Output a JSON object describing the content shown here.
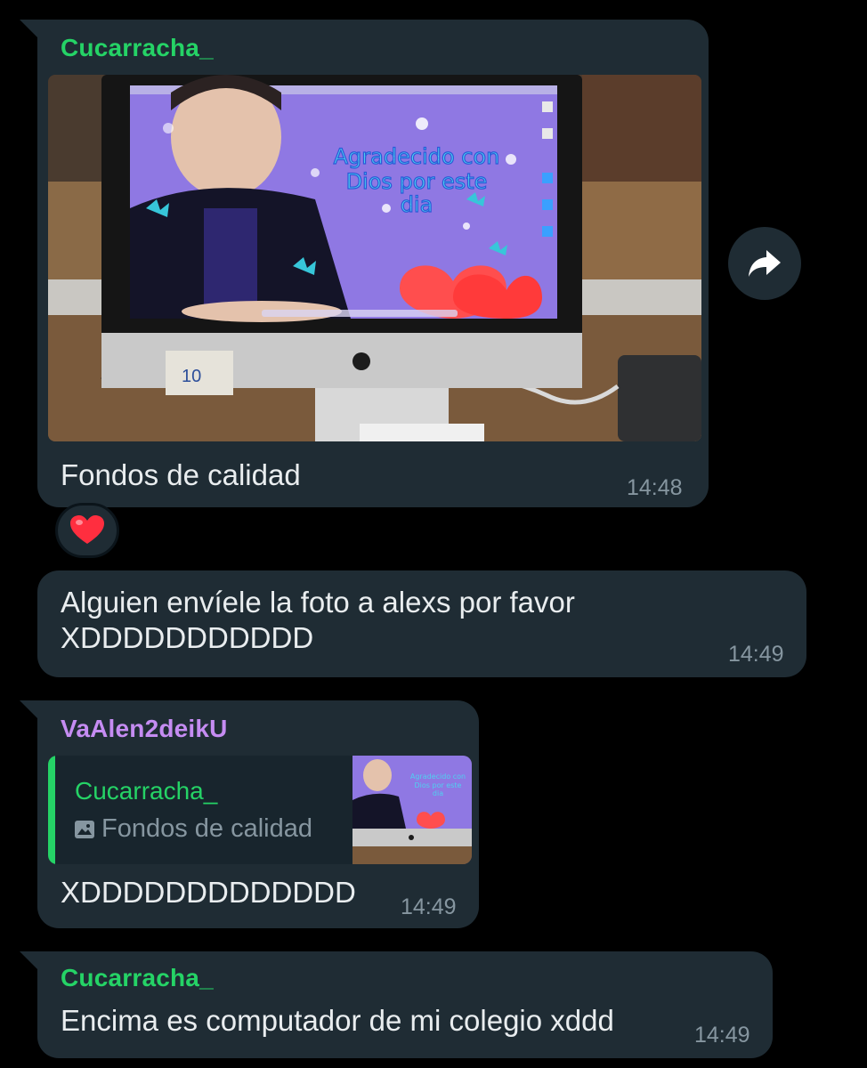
{
  "colors": {
    "background": "#000000",
    "bubble": "#1f2c34",
    "cucarracha_name": "#25d366",
    "vaalen_name": "#c58cf2",
    "time": "#8696a0"
  },
  "messages": [
    {
      "sender": "Cucarracha_",
      "image": {
        "screen_text_line1": "Agradecido con",
        "screen_text_line2": "Dios por este",
        "screen_text_line3": "dia",
        "sticker_note": "10"
      },
      "text": "Fondos de calidad",
      "time": "14:48",
      "reaction": "❤️"
    },
    {
      "text_line1": "Alguien envíele la foto a alexs por favor",
      "text_line2": "XDDDDDDDDDDD",
      "time": "14:49"
    },
    {
      "sender": "VaAlen2deikU",
      "quote": {
        "sender": "Cucarracha_",
        "text": "Fondos de calidad",
        "thumb_text_line1": "Agradecido con",
        "thumb_text_line2": "Dios por este",
        "thumb_text_line3": "dia"
      },
      "text": "XDDDDDDDDDDDDD",
      "time": "14:49"
    },
    {
      "sender": "Cucarracha_",
      "text": "Encima es computador de mi colegio xddd",
      "time": "14:49"
    }
  ],
  "icons": {
    "forward": "forward-arrow-icon",
    "image": "image-icon",
    "heart": "heart-icon"
  }
}
